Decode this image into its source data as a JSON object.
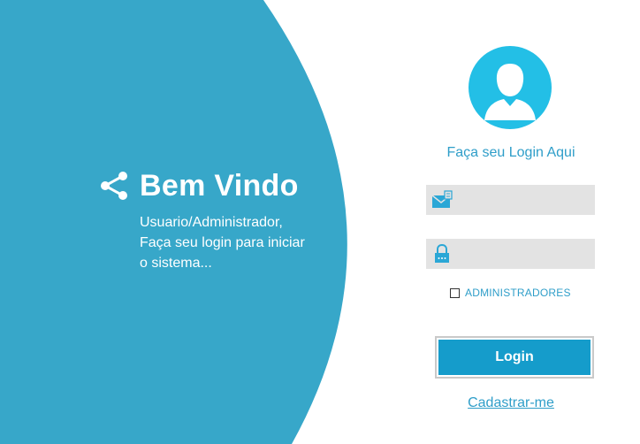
{
  "colors": {
    "panel_blue": "#37a7c9",
    "accent_blue": "#2f9ec9",
    "avatar_blue": "#23bfe6",
    "button_blue": "#159ccb",
    "field_gray": "#e3e3e3"
  },
  "welcome": {
    "title": "Bem Vindo",
    "subtitle": "Usuario/Administrador, Faça seu login para iniciar o sistema...",
    "icon": "share-icon"
  },
  "login_form": {
    "avatar_icon": "user-avatar-icon",
    "heading": "Faça seu Login Aqui",
    "username": {
      "icon": "mail-icon",
      "value": "",
      "placeholder": ""
    },
    "password": {
      "icon": "lock-icon",
      "value": "",
      "placeholder": ""
    },
    "admin_checkbox": {
      "label": "ADMINISTRADORES",
      "checked": false
    },
    "login_button": "Login",
    "register_link": "Cadastrar-me"
  }
}
